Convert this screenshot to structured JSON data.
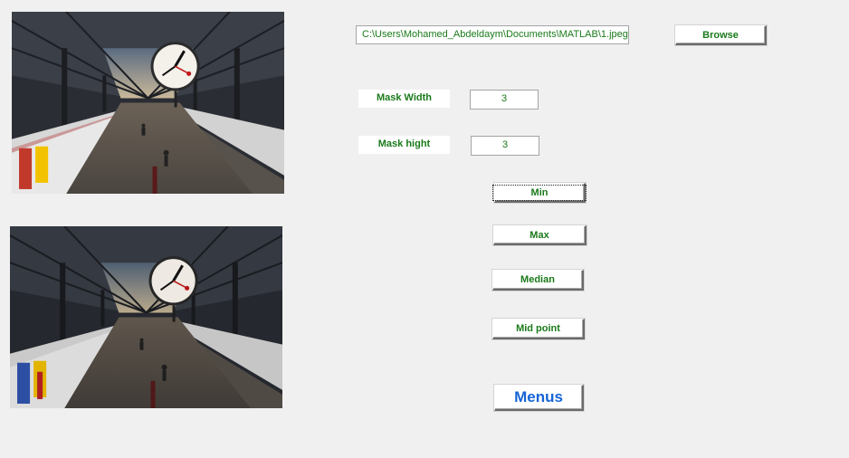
{
  "file": {
    "path_value": "C:\\Users\\Mohamed_Abdeldaym\\Documents\\MATLAB\\1.jpeg",
    "browse_label": "Browse"
  },
  "mask": {
    "width_label": "Mask Width",
    "width_value": "3",
    "height_label": "Mask hight",
    "height_value": "3"
  },
  "filters": {
    "min_label": "Min",
    "max_label": "Max",
    "median_label": "Median",
    "midpoint_label": "Mid point"
  },
  "menus_label": "Menus",
  "images": {
    "original_icon": "train-station-photo-icon",
    "filtered_icon": "train-station-photo-icon"
  },
  "colors": {
    "label_green": "#1a7a1a",
    "menus_blue": "#1565d6",
    "window_bg": "#f0f0f0"
  }
}
